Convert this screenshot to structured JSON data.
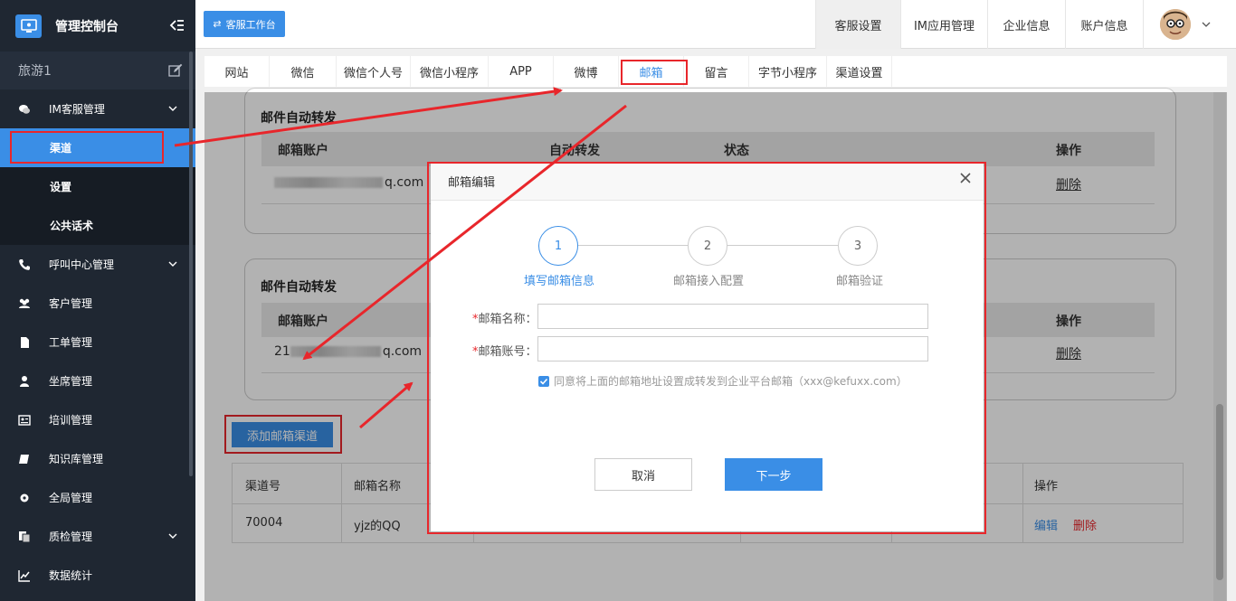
{
  "sidebar": {
    "title": "管理控制台",
    "tenant": "旅游1",
    "menu": [
      {
        "label": "IM客服管理",
        "icon": "chat-icon",
        "expanded": true,
        "sub": [
          "渠道",
          "设置",
          "公共话术"
        ]
      },
      {
        "label": "呼叫中心管理",
        "icon": "phone-icon",
        "expanded": false
      },
      {
        "label": "客户管理",
        "icon": "users-icon"
      },
      {
        "label": "工单管理",
        "icon": "document-icon"
      },
      {
        "label": "坐席管理",
        "icon": "person-icon"
      },
      {
        "label": "培训管理",
        "icon": "training-icon"
      },
      {
        "label": "知识库管理",
        "icon": "book-icon"
      },
      {
        "label": "全局管理",
        "icon": "gear-icon"
      },
      {
        "label": "质检管理",
        "icon": "copy-icon",
        "expanded": false
      },
      {
        "label": "数据统计",
        "icon": "chart-icon"
      }
    ]
  },
  "topbar": {
    "workspace_button": "客服工作台",
    "nav": [
      "客服设置",
      "IM应用管理",
      "企业信息",
      "账户信息"
    ],
    "active_nav": "客服设置"
  },
  "tabs": [
    "网站",
    "微信",
    "微信个人号",
    "微信小程序",
    "APP",
    "微博",
    "邮箱",
    "留言",
    "字节小程序",
    "渠道设置"
  ],
  "active_tab": "邮箱",
  "cards": [
    {
      "title": "邮件自动转发",
      "headers": [
        "邮箱账户",
        "自动转发",
        "状态",
        "操作"
      ],
      "account_suffix": "q.com",
      "action": "删除"
    },
    {
      "title": "邮件自动转发",
      "headers": [
        "邮箱账户",
        "操作"
      ],
      "account_prefix": "21",
      "account_suffix": "q.com",
      "action": "删除"
    }
  ],
  "add_button": "添加邮箱渠道",
  "table": {
    "headers": [
      "渠道号",
      "邮箱名称",
      "操作"
    ],
    "rows": [
      {
        "id": "70004",
        "name": "yjz的QQ",
        "edit": "编辑",
        "delete": "删除"
      }
    ]
  },
  "modal": {
    "title": "邮箱编辑",
    "steps": [
      {
        "num": "1",
        "label": "填写邮箱信息"
      },
      {
        "num": "2",
        "label": "邮箱接入配置"
      },
      {
        "num": "3",
        "label": "邮箱验证"
      }
    ],
    "fields": [
      {
        "label": "邮箱名称：",
        "value": "",
        "placeholder": ""
      },
      {
        "label": "邮箱账号：",
        "value": "",
        "placeholder": ""
      }
    ],
    "agree_text": "同意将上面的邮箱地址设置成转发到企业平台邮箱（xxx@kefuxx.com）",
    "cancel": "取消",
    "next": "下一步"
  },
  "colors": {
    "accent": "#3a8ee6",
    "highlight": "#e8262b",
    "sidebar": "#1f2732"
  }
}
